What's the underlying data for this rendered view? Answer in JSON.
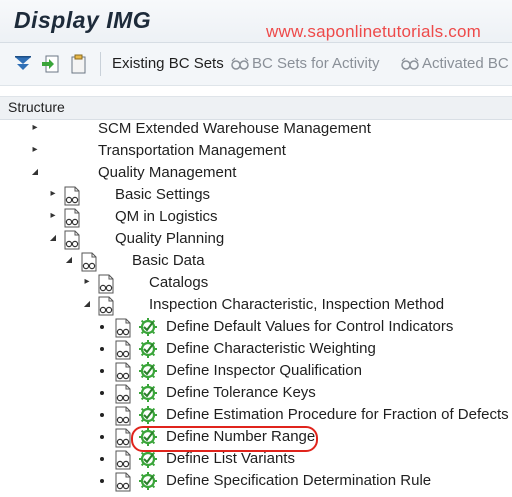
{
  "window": {
    "title": "Display IMG",
    "watermark": "www.saponlinetutorials.com"
  },
  "toolbar": {
    "icons": [
      "hierarchy-filter-icon",
      "export-icon",
      "clipboard-icon"
    ],
    "existing_bc_sets": "Existing BC Sets",
    "bc_sets_for_activity": "BC Sets for Activity",
    "activated_bc": "Activated BC"
  },
  "structure": {
    "header": "Structure",
    "items": [
      {
        "label": "SCM Extended Warehouse Management",
        "expander": "collapsed"
      },
      {
        "label": "Transportation Management",
        "expander": "collapsed"
      },
      {
        "label": "Quality Management",
        "expander": "expanded"
      },
      {
        "label": "Basic Settings",
        "expander": "collapsed",
        "icon": "img-doc-icon"
      },
      {
        "label": "QM in Logistics",
        "expander": "collapsed",
        "icon": "img-doc-icon"
      },
      {
        "label": "Quality Planning",
        "expander": "expanded",
        "icon": "img-doc-icon"
      },
      {
        "label": "Basic Data",
        "expander": "expanded",
        "icon": "img-doc-icon"
      },
      {
        "label": "Catalogs",
        "expander": "collapsed",
        "icon": "img-doc-icon"
      },
      {
        "label": "Inspection Characteristic, Inspection Method",
        "expander": "expanded",
        "icon": "img-doc-icon"
      },
      {
        "label": "Define Default Values for Control Indicators",
        "expander": "leaf",
        "icon": "execute-icon"
      },
      {
        "label": "Define Characteristic Weighting",
        "expander": "leaf",
        "icon": "execute-icon"
      },
      {
        "label": "Define Inspector Qualification",
        "expander": "leaf",
        "icon": "execute-icon"
      },
      {
        "label": "Define Tolerance Keys",
        "expander": "leaf",
        "icon": "execute-icon"
      },
      {
        "label": "Define Estimation Procedure for Fraction of Defects",
        "expander": "leaf",
        "icon": "execute-icon"
      },
      {
        "label": "Define Number Range",
        "expander": "leaf",
        "icon": "execute-icon",
        "highlighted": true
      },
      {
        "label": "Define List Variants",
        "expander": "leaf",
        "icon": "execute-icon"
      },
      {
        "label": "Define Specification Determination Rule",
        "expander": "leaf",
        "icon": "execute-icon"
      }
    ]
  },
  "colors": {
    "highlight": "#e0241c",
    "watermark": "#ee4a4a",
    "exec_green": "#3aa53a"
  }
}
